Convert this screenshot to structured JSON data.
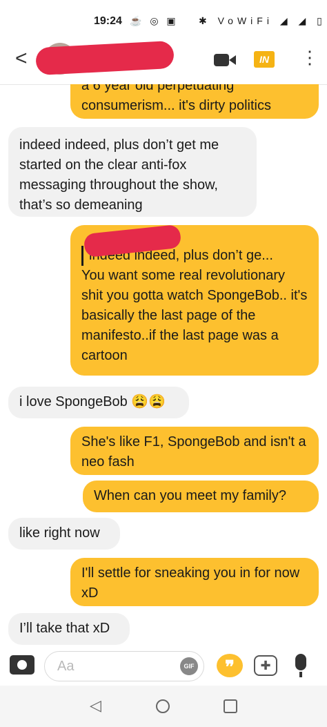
{
  "status_bar": {
    "time": "19:24",
    "left_icons": "☕ ◎ ▣",
    "right_icons": "✱ VoWiFi ◢ ◢ ▯"
  },
  "header": {
    "back_glyph": "<",
    "badge_label": "IN",
    "more_glyph": "⋮",
    "brand_color": "#fdc02f"
  },
  "messages": [
    {
      "from": "me",
      "text": "a 6 year old perpetuating consumerism... it's dirty politics"
    },
    {
      "from": "them",
      "text": "indeed indeed, plus don’t get me started on the clear anti-fox messaging throughout the show, that’s so demeaning"
    },
    {
      "from": "me",
      "quote": "indeed indeed, plus don’t ge...",
      "text": "You want some real revolutionary shit you gotta watch SpongeBob.. it's basically the last page of the manifesto..if the last page was a cartoon"
    },
    {
      "from": "them",
      "text": "i love SpongeBob 😩😩"
    },
    {
      "from": "me",
      "text": "She's like F1, SpongeBob and isn't a neo fash"
    },
    {
      "from": "me",
      "text": "When can you meet my family?"
    },
    {
      "from": "them",
      "text": "like right now"
    },
    {
      "from": "me",
      "text": "I'll settle for sneaking you in for now xD"
    },
    {
      "from": "them",
      "text": "I’ll take that xD"
    }
  ],
  "compose": {
    "placeholder": "Aa",
    "gif_label": "GIF",
    "quote_glyph": "❞",
    "sticker_glyph": "✚"
  },
  "navbar": {
    "back_glyph": "◁"
  }
}
